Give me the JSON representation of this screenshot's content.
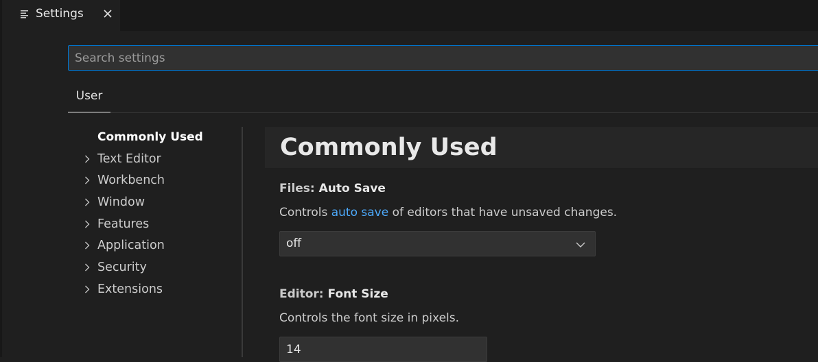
{
  "tab": {
    "title": "Settings",
    "icon": "settings-list-icon"
  },
  "search": {
    "placeholder": "Search settings",
    "value": ""
  },
  "scope_tabs": [
    {
      "label": "User",
      "active": true
    }
  ],
  "toc": {
    "items": [
      {
        "label": "Commonly Used",
        "active": true,
        "expandable": false
      },
      {
        "label": "Text Editor",
        "active": false,
        "expandable": true
      },
      {
        "label": "Workbench",
        "active": false,
        "expandable": true
      },
      {
        "label": "Window",
        "active": false,
        "expandable": true
      },
      {
        "label": "Features",
        "active": false,
        "expandable": true
      },
      {
        "label": "Application",
        "active": false,
        "expandable": true
      },
      {
        "label": "Security",
        "active": false,
        "expandable": true
      },
      {
        "label": "Extensions",
        "active": false,
        "expandable": true
      }
    ]
  },
  "section": {
    "title": "Commonly Used"
  },
  "settings": {
    "auto_save": {
      "category": "Files: ",
      "name": "Auto Save",
      "desc_before": "Controls ",
      "desc_link": "auto save",
      "desc_after": " of editors that have unsaved changes.",
      "value": "off"
    },
    "font_size": {
      "category": "Editor: ",
      "name": "Font Size",
      "desc": "Controls the font size in pixels.",
      "value": "14"
    }
  },
  "colors": {
    "accent": "#0078d4",
    "link": "#4daafc",
    "background": "#1f1f1f"
  }
}
